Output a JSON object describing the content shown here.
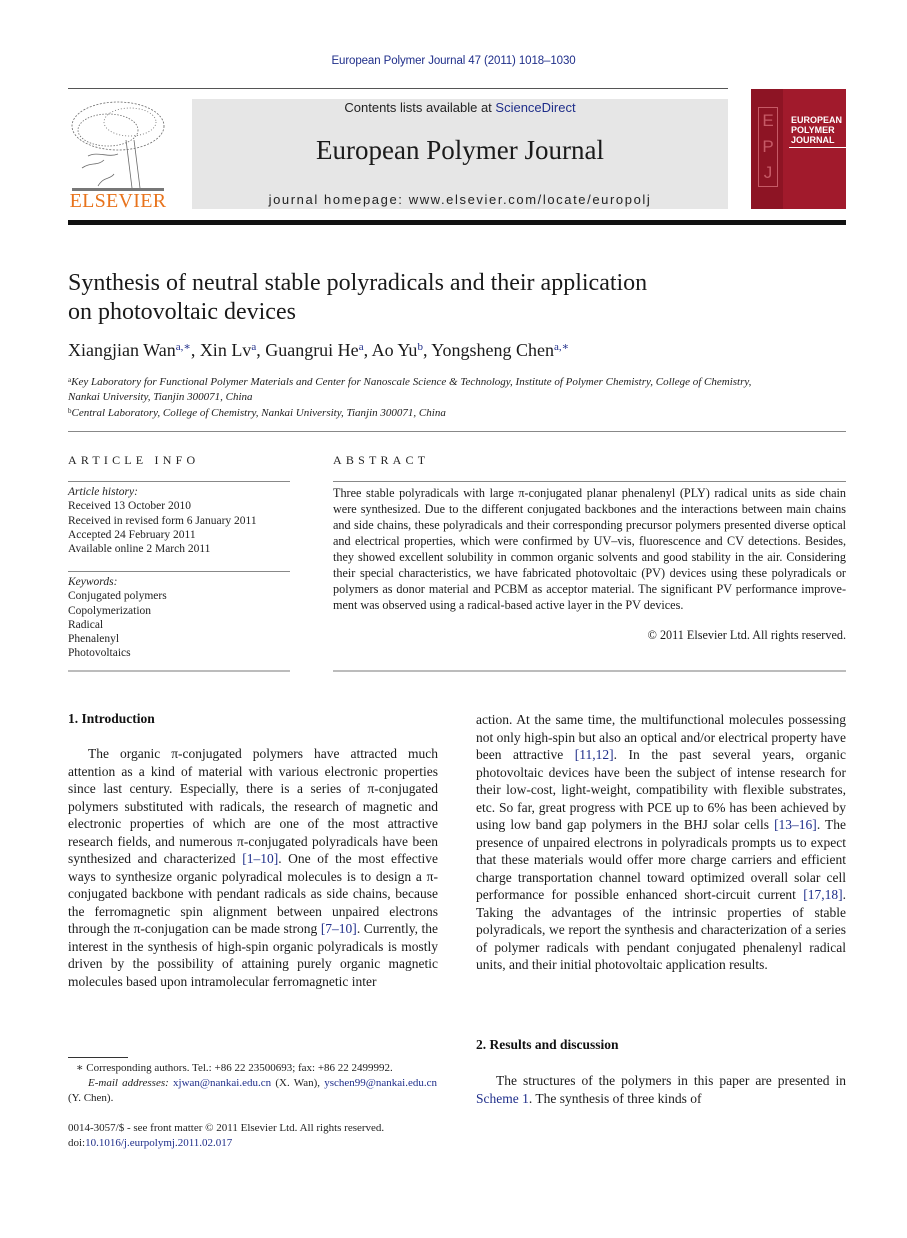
{
  "header": {
    "running_head": "European Polymer Journal 47 (2011) 1018–1030",
    "publisher_logo": "ELSEVIER",
    "contents_prefix": "Contents lists available at ",
    "contents_link": "ScienceDirect",
    "journal_title": "European Polymer Journal",
    "homepage": "journal homepage: www.elsevier.com/locate/europolj",
    "cover": {
      "letters": [
        "E",
        "P",
        "J"
      ],
      "title_lines": [
        "EUROPEAN",
        "POLYMER",
        "JOURNAL"
      ],
      "color": "#a11a2c"
    }
  },
  "article": {
    "title_line1": "Synthesis of neutral stable polyradicals and their application",
    "title_line2": "on photovoltaic devices",
    "authors": [
      {
        "name": "Xiangjian Wan",
        "sup": "a,∗"
      },
      {
        "name": "Xin Lv",
        "sup": "a"
      },
      {
        "name": "Guangrui He",
        "sup": "a"
      },
      {
        "name": "Ao Yu",
        "sup": "b"
      },
      {
        "name": "Yongsheng Chen",
        "sup": "a,∗"
      }
    ],
    "affiliations": [
      {
        "mark": "a",
        "text_line1": "Key Laboratory for Functional Polymer Materials and Center for Nanoscale Science & Technology, Institute of Polymer Chemistry, College of Chemistry,",
        "text_line2": "Nankai University, Tianjin 300071, China"
      },
      {
        "mark": "b",
        "text_line1": "Central Laboratory, College of Chemistry, Nankai University, Tianjin 300071, China"
      }
    ]
  },
  "article_info": {
    "heading": "ARTICLE INFO",
    "history_label": "Article history:",
    "history": [
      "Received 13 October 2010",
      "Received in revised form 6 January 2011",
      "Accepted 24 February 2011",
      "Available online 2 March 2011"
    ],
    "keywords_label": "Keywords:",
    "keywords": [
      "Conjugated polymers",
      "Copolymerization",
      "Radical",
      "Phenalenyl",
      "Photovoltaics"
    ]
  },
  "abstract": {
    "heading": "ABSTRACT",
    "text": "Three stable polyradicals with large π-conjugated planar phenalenyl (PLY) radical units as side chain were synthesized. Due to the different conjugated backbones and the interac­tions between main chains and side chains, these polyradicals and their corresponding pre­cursor polymers presented diverse optical and electrical properties, which were confirmed by UV–vis, fluorescence and CV detections. Besides, they showed excellent solubility in common organic solvents and good stability in the air. Considering their special character­istics, we have fabricated photovoltaic (PV) devices using these polyradicals or polymers as donor material and PCBM as acceptor material. The significant PV performance improve­ment was observed using a radical-based active layer in the PV devices.",
    "copyright": "© 2011 Elsevier Ltd. All rights reserved."
  },
  "body": {
    "intro_heading": "1. Introduction",
    "intro_p1_a": "The organic π-conjugated polymers have attracted much attention as a kind of material with various elec­tronic properties since last century. Especially, there is a series of π-conjugated polymers substituted with radicals, the research of magnetic and electronic properties of which are one of the most attractive research fields, and numerous π-conjugated polyradicals have been synthe­sized and characterized ",
    "ref_1_10": "[1–10]",
    "intro_p1_b": ". One of the most effective ways to synthesize organic polyradical molecules is to de­sign a π-conjugated backbone with pendant radicals as side chains, because the ferromagnetic spin alignment be­tween unpaired electrons through the π-conjugation can be made strong ",
    "ref_7_10": "[7–10]",
    "intro_p1_c": ". Currently, the interest in the syn­thesis of high-spin organic polyradicals is mostly driven by the possibility of attaining purely organic magnetic molecules based upon intramolecular ferromagnetic inter­",
    "col2_a": "action. At the same time, the multifunctional molecules possessing not only high-spin but also an optical and/or electrical property have been attractive ",
    "ref_11_12": "[11,12]",
    "col2_b": ". In the past several years, organic photovoltaic devices have been the subject of intense research for their low-cost, light-weight, compatibility with flexible substrates, etc. So far, great pro­gress with PCE up to 6% has been achieved by using low band gap polymers in the BHJ solar cells ",
    "ref_13_16": "[13–16]",
    "col2_c": ". The pres­ence of unpaired electrons in polyradicals prompts us to expect that these materials would offer more charge carri­ers and efficient charge transportation channel toward optimized overall solar cell performance for possible en­hanced short-circuit current ",
    "ref_17_18": "[17,18]",
    "col2_d": ". Taking the advanta­ges of the intrinsic properties of stable polyradicals, we report the synthesis and characterization of a series of polymer radicals with pendant conjugated phenalenyl rad­ical units, and their initial photovoltaic application results.",
    "results_heading": "2. Results and discussion",
    "results_p1_a": "The structures of the polymers in this paper are pre­sented in ",
    "scheme_ref": "Scheme 1",
    "results_p1_b": ". The synthesis of three kinds of"
  },
  "footnotes": {
    "corresponding": "∗ Corresponding authors. Tel.: +86 22 23500693; fax: +86 22 2499992.",
    "email_label": "E-mail addresses: ",
    "email1": "xjwan@nankai.edu.cn",
    "email1_who": " (X. Wan), ",
    "email2": "yschen99@nankai.edu.cn",
    "email2_who": " (Y. Chen).",
    "front_matter": "0014-3057/$ - see front matter © 2011 Elsevier Ltd. All rights reserved.",
    "doi_label": "doi:",
    "doi": "10.1016/j.eurpolymj.2011.02.017"
  }
}
